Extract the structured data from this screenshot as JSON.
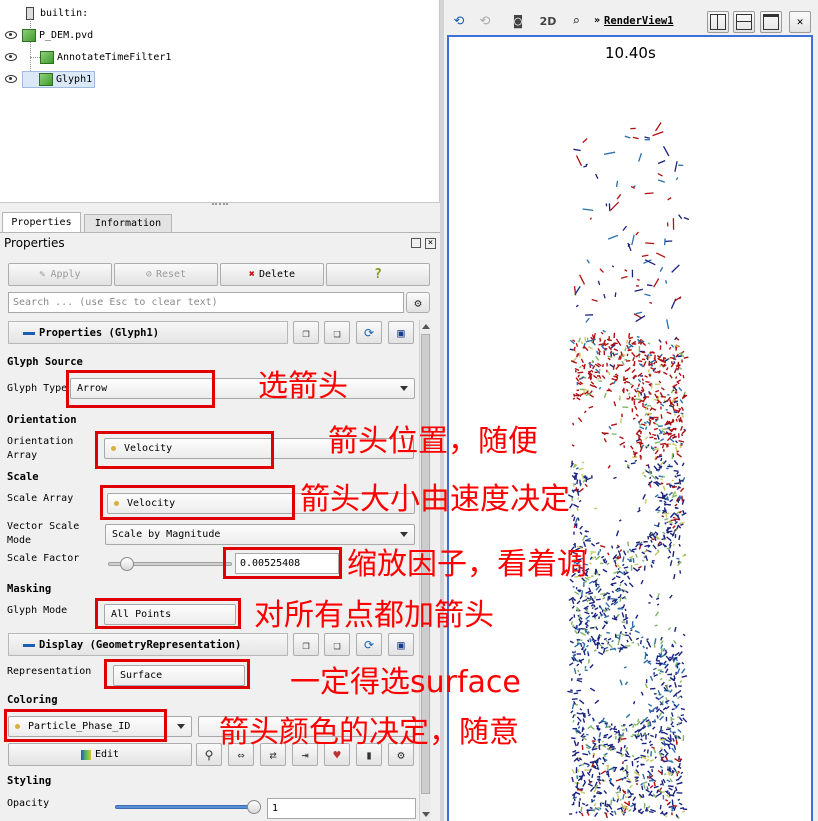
{
  "pipeline": {
    "items": [
      {
        "label": "builtin:"
      },
      {
        "label": "P_DEM.pvd"
      },
      {
        "label": "AnnotateTimeFilter1"
      },
      {
        "label": "Glyph1"
      }
    ]
  },
  "tabs": {
    "properties": "Properties",
    "information": "Information"
  },
  "panel": {
    "title": "Properties",
    "buttons": {
      "apply": "Apply",
      "reset": "Reset",
      "delete": "Delete",
      "help": "?"
    },
    "search_placeholder": "Search ... (use Esc to clear text)",
    "section_glyph": "Properties (Glyph1)",
    "glyph_source_header": "Glyph Source",
    "glyph_type_label": "Glyph Type",
    "glyph_type_value": "Arrow",
    "orientation_header": "Orientation",
    "orientation_array_label_1": "Orientation",
    "orientation_array_label_2": "Array",
    "orientation_array_value": "Velocity",
    "scale_header": "Scale",
    "scale_array_label": "Scale Array",
    "scale_array_value": "Velocity",
    "vector_scale_label_1": "Vector Scale",
    "vector_scale_label_2": "Mode",
    "vector_scale_value": "Scale by Magnitude",
    "scale_factor_label": "Scale Factor",
    "scale_factor_value": "0.00525408",
    "masking_header": "Masking",
    "glyph_mode_label": "Glyph Mode",
    "glyph_mode_value": "All Points",
    "section_display": "Display (GeometryRepresentation)",
    "representation_label": "Representation",
    "representation_value": "Surface",
    "coloring_header": "Coloring",
    "coloring_value": "Particle_Phase_ID",
    "edit_label": "Edit",
    "styling_header": "Styling",
    "opacity_label": "Opacity",
    "opacity_value": "1"
  },
  "annotations": {
    "glyph_type": "选箭头",
    "orientation": "箭头位置，随便",
    "scale": "箭头大小由速度决定",
    "scale_factor": "缩放因子，看着调",
    "glyph_mode": "对所有点都加箭头",
    "representation": "一定得选surface",
    "coloring": "箭头颜色的决定，随意"
  },
  "render_view": {
    "mode_2d": "2D",
    "name": "RenderView1",
    "time_label": "10.40s"
  },
  "colors": {
    "annotation_red": "#ff0000",
    "viewport_border": "#3d6fd8",
    "particle_colors": [
      "#b01010",
      "#1a237e",
      "#2a6fa8",
      "#7fb56a",
      "#c8c860"
    ]
  }
}
